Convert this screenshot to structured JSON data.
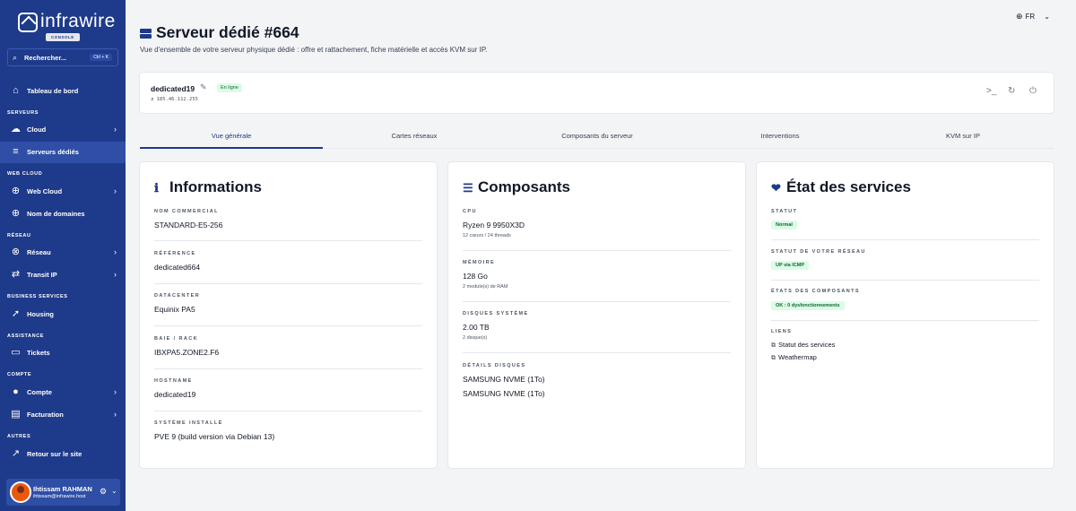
{
  "brand": {
    "name": "infrawire",
    "badge": "CONSOLE"
  },
  "search": {
    "label": "Rechercher...",
    "shortcut": "Ctrl + K"
  },
  "sidebar": {
    "dashboard": "Tableau de bord",
    "sections": {
      "servers": "SERVEURS",
      "web_cloud": "WEB CLOUD",
      "network": "RÉSEAU",
      "business": "BUSINESS SERVICES",
      "support": "ASSISTANCE",
      "account": "COMPTE",
      "other": "AUTRES"
    },
    "items": {
      "cloud": "Cloud",
      "dedicated": "Serveurs dédiés",
      "web_cloud": "Web Cloud",
      "domains": "Nom de domaines",
      "network": "Réseau",
      "ip_transit": "Transit IP",
      "housing": "Housing",
      "tickets": "Tickets",
      "account": "Compte",
      "billing": "Facturation",
      "back_site": "Retour sur le site"
    }
  },
  "user": {
    "name": "Ihtissam RAHMAN",
    "email": "ihtissam@infrawire.host"
  },
  "topbar": {
    "language": "FR"
  },
  "header": {
    "title": "Serveur dédié #664",
    "subtitle": "Vue d'ensemble de votre serveur physique dédié : offre et rattachement, fiche matérielle et accès KVM sur IP."
  },
  "server": {
    "name": "dedicated19",
    "status": "En ligne",
    "ip": "185.46.112.255"
  },
  "tabs": [
    "Vue générale",
    "Cartes réseaux",
    "Composants du serveur",
    "Interventions",
    "KVM sur IP"
  ],
  "info": {
    "title": "Informations",
    "fields": [
      {
        "label": "NOM COMMERCIAL",
        "value": "STANDARD-E5-256"
      },
      {
        "label": "RÉFÉRENCE",
        "value": "dedicated664"
      },
      {
        "label": "DATACENTER",
        "value": "Equinix PA5"
      },
      {
        "label": "BAIE / RACK",
        "value": "IBXPA5.ZONE2.F6"
      },
      {
        "label": "HOSTNAME",
        "value": "dedicated19"
      },
      {
        "label": "SYSTÈME INSTALLÉ",
        "value": "PVE 9 (build version via Debian 13)"
      }
    ]
  },
  "components": {
    "title": "Composants",
    "cpu": {
      "label": "CPU",
      "value": "Ryzen 9 9950X3D",
      "sub": "12 cœurs / 24 threads"
    },
    "memory": {
      "label": "MÉMOIRE",
      "value": "128 Go",
      "sub": "2 module(s) de RAM"
    },
    "disks": {
      "label": "DISQUES SYSTÈME",
      "value": "2.00 TB",
      "sub": "2 disque(s)"
    },
    "disk_details": {
      "label": "DÉTAILS DISQUES",
      "items": [
        "SAMSUNG NVME (1To)",
        "SAMSUNG NVME (1To)"
      ]
    }
  },
  "services": {
    "title": "État des services",
    "status": {
      "label": "STATUT",
      "value": "Normal"
    },
    "network": {
      "label": "STATUT DE VOTRE RÉSEAU",
      "value": "UP via ICMP"
    },
    "components": {
      "label": "ÉTATS DES COMPOSANTS",
      "value": "OK : 0 dysfonctionnements"
    },
    "links": {
      "label": "LIENS",
      "items": [
        "Statut des services",
        "Weathermap"
      ]
    }
  }
}
